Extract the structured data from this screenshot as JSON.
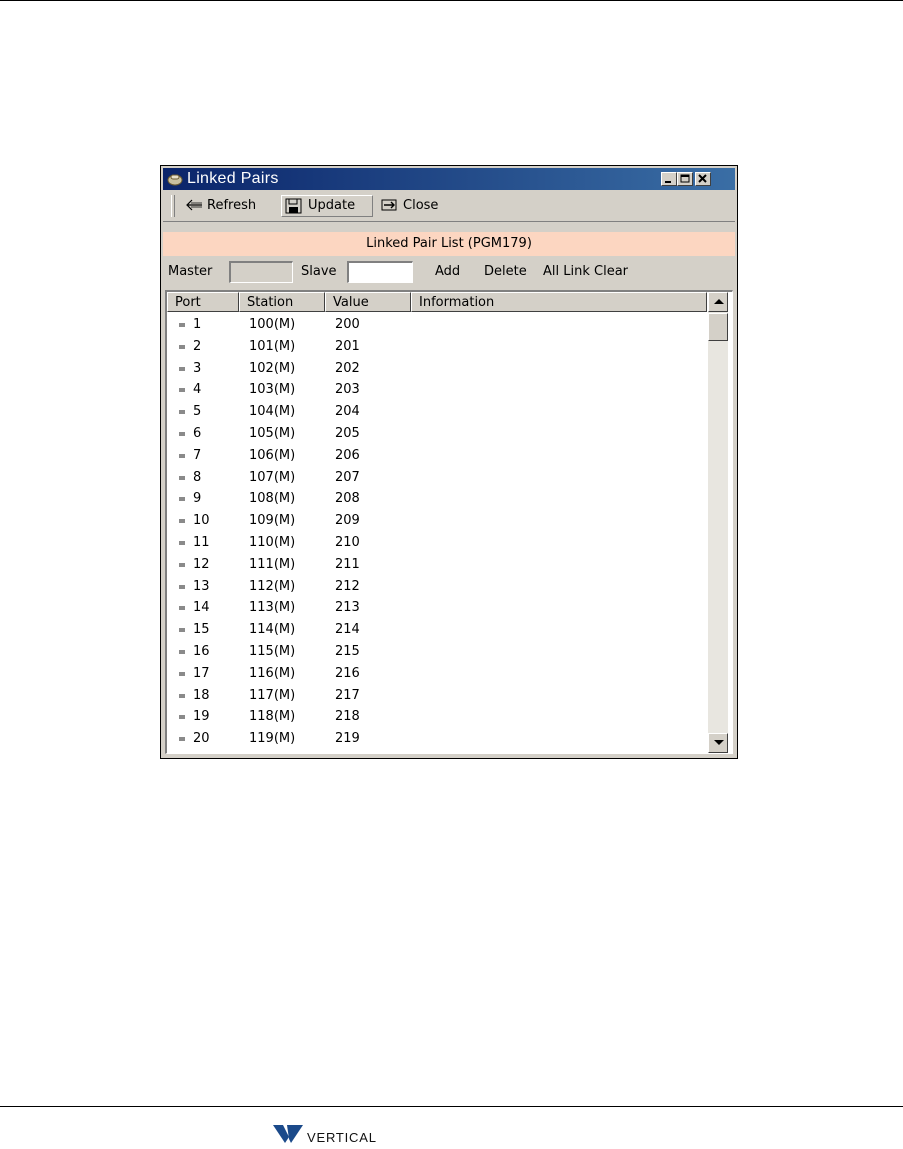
{
  "window": {
    "title": "Linked Pairs",
    "colors": {
      "titlebar_start": "#0a246a",
      "titlebar_end": "#3a6ea5",
      "banner": "#fcd6c1",
      "chrome": "#d4d0c8"
    }
  },
  "toolbar": {
    "refresh_label": "Refresh",
    "update_label": "Update",
    "close_label": "Close"
  },
  "banner": {
    "text": "Linked Pair List (PGM179)"
  },
  "filter": {
    "master_label": "Master",
    "master_value": "",
    "slave_label": "Slave",
    "slave_value": "",
    "add_label": "Add",
    "delete_label": "Delete",
    "all_link_clear_label": "All Link Clear"
  },
  "table": {
    "headers": {
      "port": "Port",
      "station": "Station",
      "value": "Value",
      "information": "Information"
    },
    "rows": [
      {
        "port": "1",
        "station": "100(M)",
        "value": "200",
        "information": ""
      },
      {
        "port": "2",
        "station": "101(M)",
        "value": "201",
        "information": ""
      },
      {
        "port": "3",
        "station": "102(M)",
        "value": "202",
        "information": ""
      },
      {
        "port": "4",
        "station": "103(M)",
        "value": "203",
        "information": ""
      },
      {
        "port": "5",
        "station": "104(M)",
        "value": "204",
        "information": ""
      },
      {
        "port": "6",
        "station": "105(M)",
        "value": "205",
        "information": ""
      },
      {
        "port": "7",
        "station": "106(M)",
        "value": "206",
        "information": ""
      },
      {
        "port": "8",
        "station": "107(M)",
        "value": "207",
        "information": ""
      },
      {
        "port": "9",
        "station": "108(M)",
        "value": "208",
        "information": ""
      },
      {
        "port": "10",
        "station": "109(M)",
        "value": "209",
        "information": ""
      },
      {
        "port": "11",
        "station": "110(M)",
        "value": "210",
        "information": ""
      },
      {
        "port": "12",
        "station": "111(M)",
        "value": "211",
        "information": ""
      },
      {
        "port": "13",
        "station": "112(M)",
        "value": "212",
        "information": ""
      },
      {
        "port": "14",
        "station": "113(M)",
        "value": "213",
        "information": ""
      },
      {
        "port": "15",
        "station": "114(M)",
        "value": "214",
        "information": ""
      },
      {
        "port": "16",
        "station": "115(M)",
        "value": "215",
        "information": ""
      },
      {
        "port": "17",
        "station": "116(M)",
        "value": "216",
        "information": ""
      },
      {
        "port": "18",
        "station": "117(M)",
        "value": "217",
        "information": ""
      },
      {
        "port": "19",
        "station": "118(M)",
        "value": "218",
        "information": ""
      },
      {
        "port": "20",
        "station": "119(M)",
        "value": "219",
        "information": ""
      }
    ]
  },
  "footer": {
    "logo_text": "VERTICAL",
    "logo_color": "#1b4a8a"
  },
  "icons": {
    "title": "phone-app-icon",
    "refresh": "back-arrow-icon",
    "update": "save-icon",
    "close": "exit-icon"
  }
}
